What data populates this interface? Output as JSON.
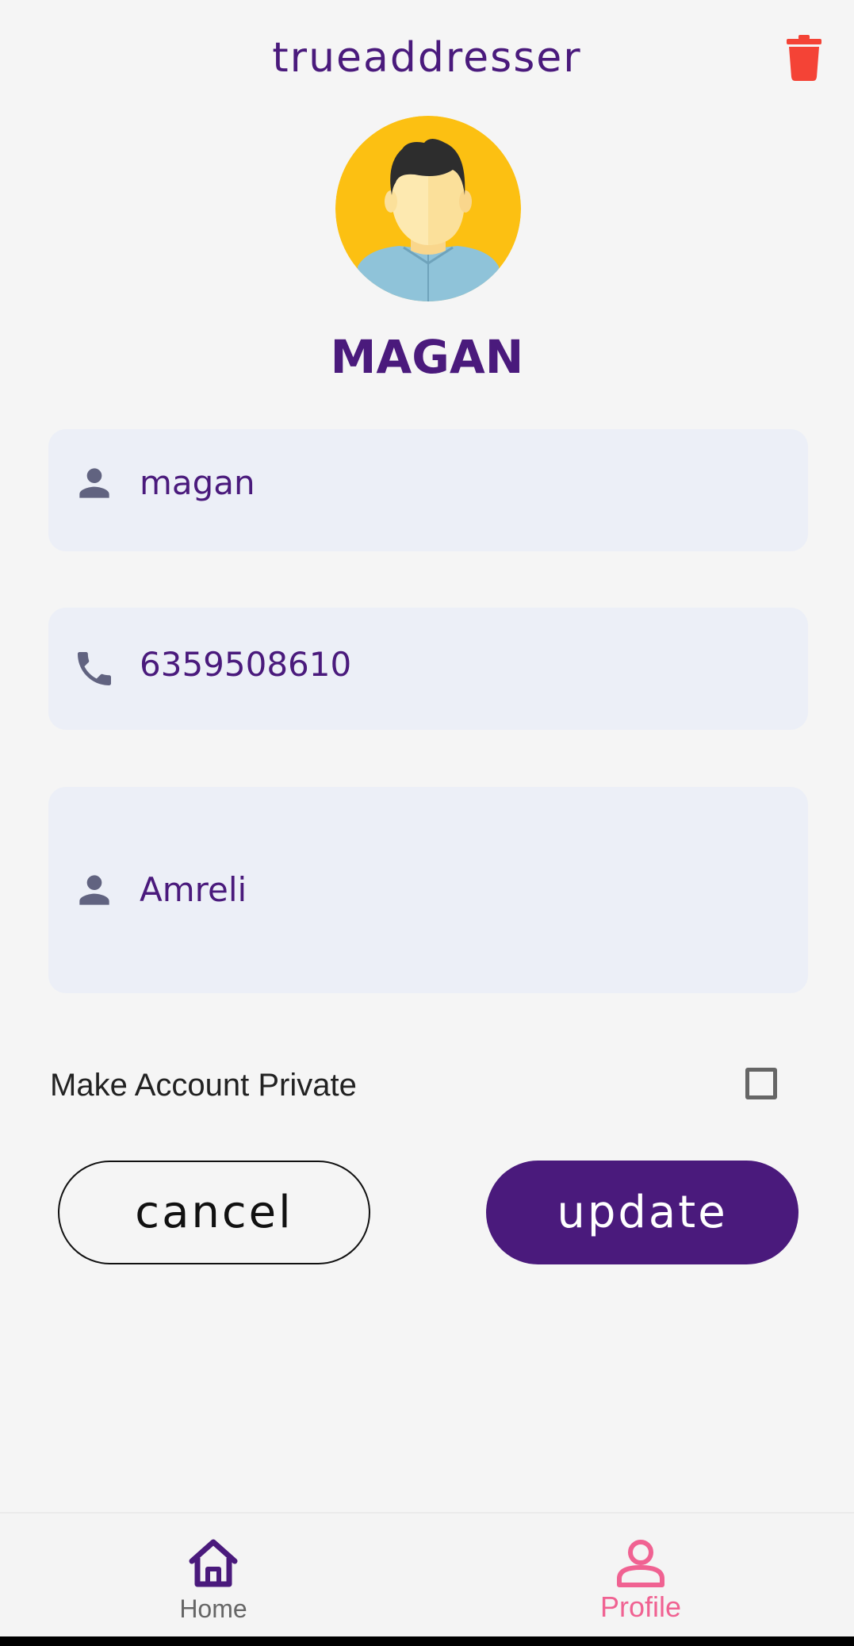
{
  "app_bar": {
    "title": "trueaddresser",
    "delete_icon": "trash-icon",
    "delete_color": "#f44336"
  },
  "profile": {
    "name": "MAGAN",
    "avatar_icon": "avatar-man-icon"
  },
  "fields": {
    "name": {
      "value": "magan",
      "icon": "person-icon"
    },
    "phone": {
      "value": "6359508610",
      "icon": "phone-icon"
    },
    "city": {
      "value": "Amreli",
      "icon": "person-icon"
    }
  },
  "privacy": {
    "label": "Make Account Private",
    "checked": false
  },
  "actions": {
    "cancel_label": "cancel",
    "update_label": "update"
  },
  "bottom_nav": {
    "items": [
      {
        "label": "Home",
        "icon": "home-icon",
        "active": false
      },
      {
        "label": "Profile",
        "icon": "profile-icon",
        "active": true
      }
    ]
  },
  "colors": {
    "primary": "#4a1a7c",
    "accent": "#f06292",
    "field_bg": "#eceff7",
    "avatar_bg": "#fcc012"
  }
}
